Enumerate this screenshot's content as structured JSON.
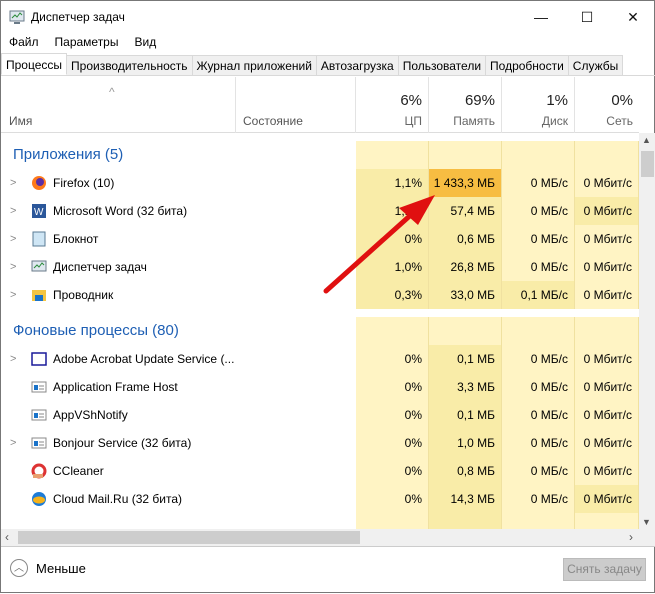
{
  "window": {
    "title": "Диспетчер задач",
    "minimize": "—",
    "maximize": "☐",
    "close": "✕"
  },
  "menu": [
    "Файл",
    "Параметры",
    "Вид"
  ],
  "tabs": [
    "Процессы",
    "Производительность",
    "Журнал приложений",
    "Автозагрузка",
    "Пользователи",
    "Подробности",
    "Службы"
  ],
  "columns": {
    "name": "Имя",
    "status": "Состояние",
    "cpu": {
      "pct": "6%",
      "label": "ЦП"
    },
    "memory": {
      "pct": "69%",
      "label": "Память"
    },
    "disk": {
      "pct": "1%",
      "label": "Диск"
    },
    "network": {
      "pct": "0%",
      "label": "Сеть"
    }
  },
  "groups": [
    {
      "title": "Приложения (5)",
      "rows": [
        {
          "name": "Firefox (10)",
          "icon": "firefox-icon",
          "expand": true,
          "cpu": "1,1%",
          "mem": "1 433,3 МБ",
          "disk": "0 МБ/с",
          "net": "0 Мбит/с"
        },
        {
          "name": "Microsoft Word (32 бита)",
          "icon": "word-icon",
          "expand": true,
          "cpu": "1,1%",
          "mem": "57,4 МБ",
          "disk": "0 МБ/с",
          "net": "0 Мбит/с"
        },
        {
          "name": "Блокнот",
          "icon": "notepad-icon",
          "expand": true,
          "cpu": "0%",
          "mem": "0,6 МБ",
          "disk": "0 МБ/с",
          "net": "0 Мбит/с"
        },
        {
          "name": "Диспетчер задач",
          "icon": "task-manager-icon",
          "expand": true,
          "cpu": "1,0%",
          "mem": "26,8 МБ",
          "disk": "0 МБ/с",
          "net": "0 Мбит/с"
        },
        {
          "name": "Проводник",
          "icon": "explorer-folder-icon",
          "expand": true,
          "cpu": "0,3%",
          "mem": "33,0 МБ",
          "disk": "0,1 МБ/с",
          "net": "0 Мбит/с"
        }
      ]
    },
    {
      "title": "Фоновые процессы (80)",
      "rows": [
        {
          "name": "Adobe Acrobat Update Service (...",
          "icon": "window-icon",
          "expand": true,
          "cpu": "0%",
          "mem": "0,1 МБ",
          "disk": "0 МБ/с",
          "net": "0 Мбит/с"
        },
        {
          "name": "Application Frame Host",
          "icon": "app-window-icon",
          "expand": false,
          "cpu": "0%",
          "mem": "3,3 МБ",
          "disk": "0 МБ/с",
          "net": "0 Мбит/с"
        },
        {
          "name": "AppVShNotify",
          "icon": "app-window-icon",
          "expand": false,
          "cpu": "0%",
          "mem": "0,1 МБ",
          "disk": "0 МБ/с",
          "net": "0 Мбит/с"
        },
        {
          "name": "Bonjour Service (32 бита)",
          "icon": "app-window-icon",
          "expand": true,
          "cpu": "0%",
          "mem": "1,0 МБ",
          "disk": "0 МБ/с",
          "net": "0 Мбит/с"
        },
        {
          "name": "CCleaner",
          "icon": "ccleaner-icon",
          "expand": false,
          "cpu": "0%",
          "mem": "0,8 МБ",
          "disk": "0 МБ/с",
          "net": "0 Мбит/с"
        },
        {
          "name": "Cloud Mail.Ru (32 бита)",
          "icon": "cloud-mail-icon",
          "expand": false,
          "cpu": "0%",
          "mem": "14,3 МБ",
          "disk": "0 МБ/с",
          "net": "0 Мбит/с"
        }
      ]
    }
  ],
  "footer": {
    "less": "Меньше",
    "end_task": "Снять задачу"
  },
  "colors": {
    "accent": "#1e5fb4",
    "heat_light": "#fff4c4",
    "heat_mid": "#f9eca8",
    "heat_high": "#f7bd42",
    "arrow": "#e01010"
  }
}
